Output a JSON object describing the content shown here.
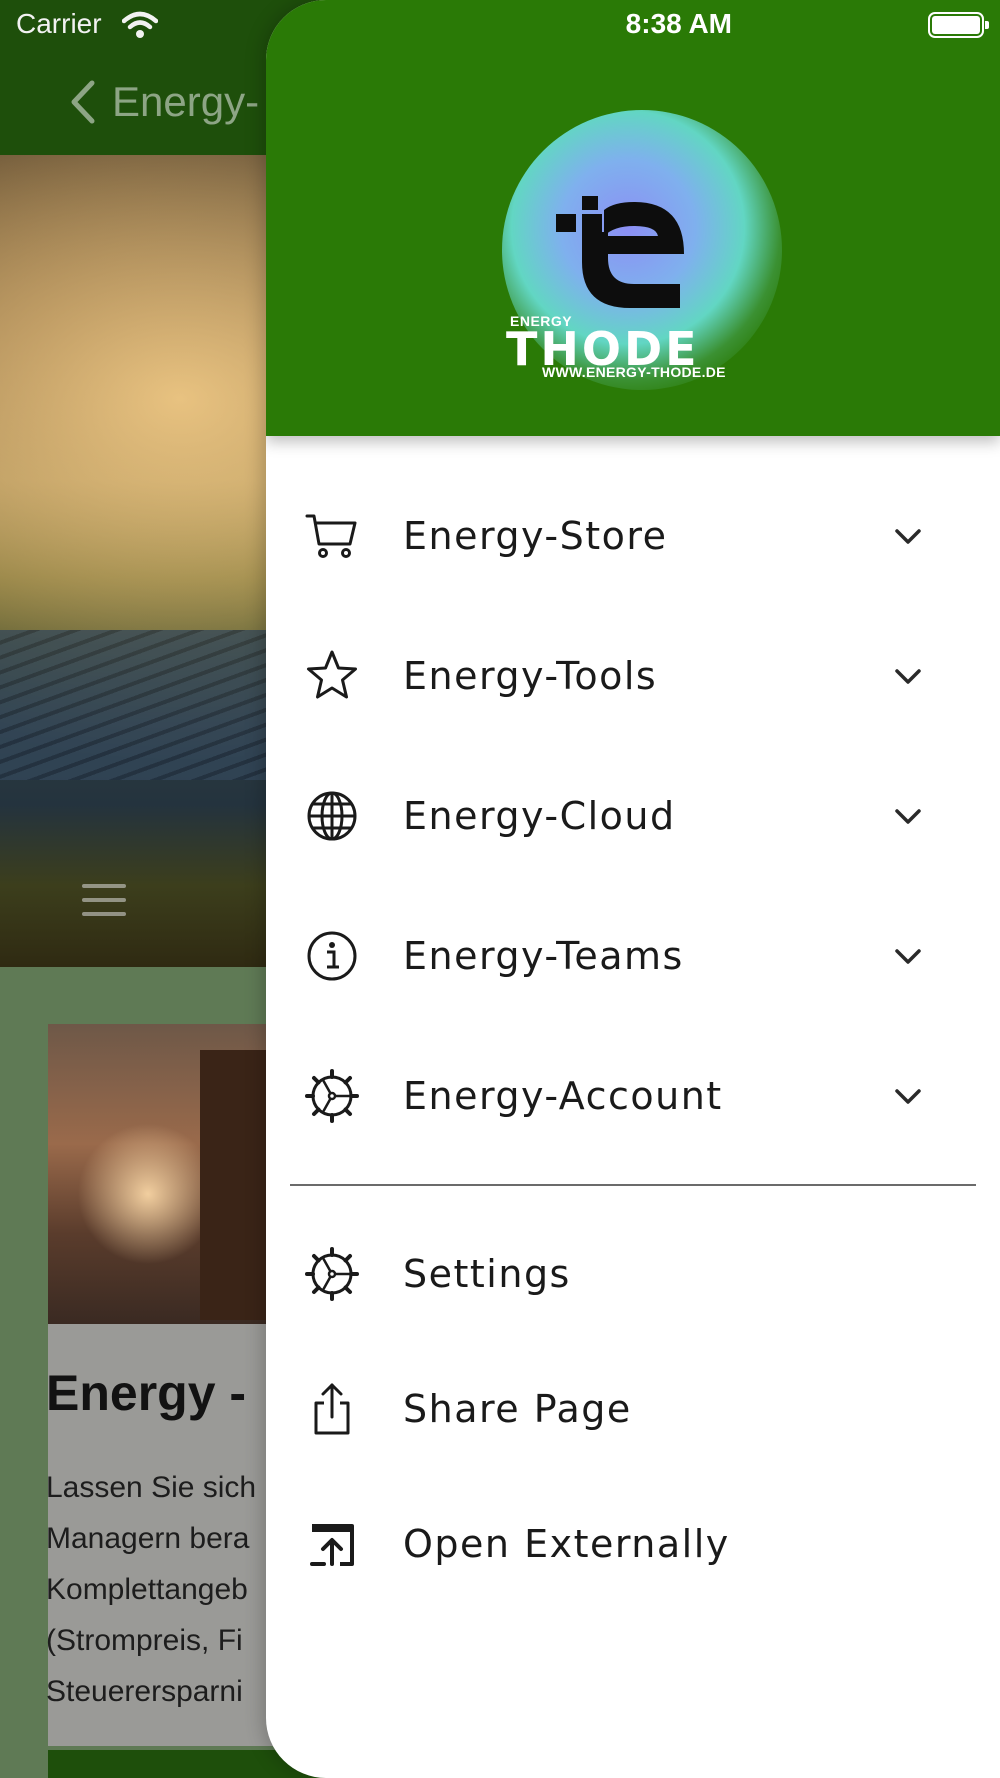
{
  "status_bar": {
    "carrier": "Carrier",
    "time": "8:38 AM"
  },
  "background": {
    "nav_title": "Energy-",
    "card_title": "Energy -",
    "card_lines": [
      "Lassen Sie sich",
      "Managern bera",
      "Komplettangeb",
      "(Strompreis, Fi",
      "Steuerersparni"
    ]
  },
  "drawer": {
    "logo": {
      "small_word": "ENERGY",
      "brand": "THODE",
      "url": "WWW.ENERGY-THODE.DE"
    },
    "menu": [
      {
        "label": "Energy-Store",
        "icon": "cart-icon",
        "expandable": true
      },
      {
        "label": "Energy-Tools",
        "icon": "star-icon",
        "expandable": true
      },
      {
        "label": "Energy-Cloud",
        "icon": "globe-icon",
        "expandable": true
      },
      {
        "label": "Energy-Teams",
        "icon": "info-icon",
        "expandable": true
      },
      {
        "label": "Energy-Account",
        "icon": "gear-icon",
        "expandable": true
      }
    ],
    "actions": [
      {
        "label": "Settings",
        "icon": "gear-icon"
      },
      {
        "label": "Share Page",
        "icon": "share-icon"
      },
      {
        "label": "Open Externally",
        "icon": "open-external-icon"
      }
    ]
  },
  "colors": {
    "header_green": "#2a7a06",
    "navbar_green": "#1e4f0b",
    "drawer_bg": "#ffffff",
    "text": "#1a1a1a"
  }
}
